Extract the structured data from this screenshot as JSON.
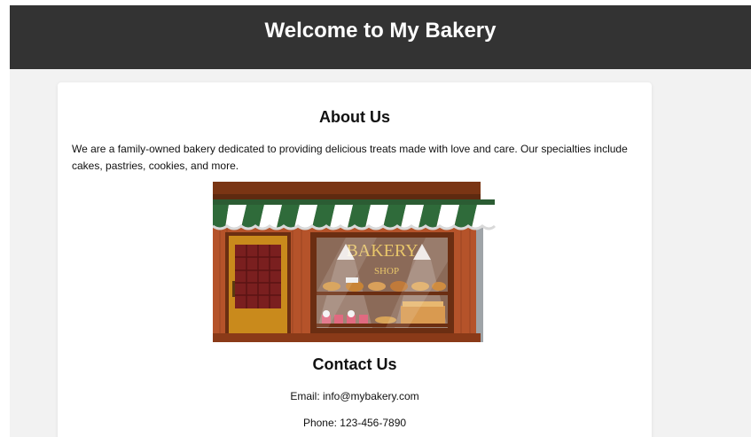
{
  "header": {
    "title": "Welcome to My Bakery"
  },
  "about": {
    "title": "About Us",
    "text": "We are a family-owned bakery dedicated to providing delicious treats made with love and care. Our specialties include cakes, pastries, cookies, and more."
  },
  "image": {
    "sign_main": "BAKERY",
    "sign_sub": "SHOP"
  },
  "contact": {
    "title": "Contact Us",
    "email": "Email: info@mybakery.com",
    "phone": "Phone: 123-456-7890"
  },
  "colors": {
    "header_bg": "#333333",
    "page_bg": "#f2f2f2",
    "awning_green": "#2f6b3a",
    "wood": "#b5532a"
  }
}
